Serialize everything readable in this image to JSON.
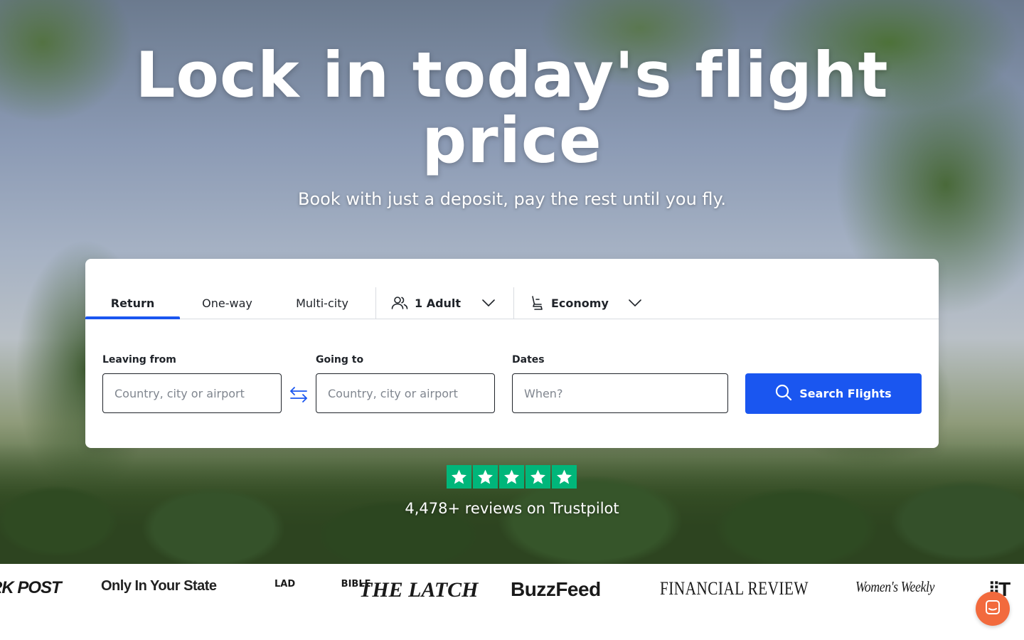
{
  "hero": {
    "title": "Lock in today's flight price",
    "subtitle": "Book with just a deposit, pay the rest until you fly."
  },
  "search": {
    "tabs": [
      {
        "label": "Return",
        "active": true
      },
      {
        "label": "One-way",
        "active": false
      },
      {
        "label": "Multi-city",
        "active": false
      }
    ],
    "passengers": {
      "label": "1 Adult",
      "icon": "users-icon"
    },
    "cabin": {
      "label": "Economy",
      "icon": "seat-icon"
    },
    "leaving": {
      "label": "Leaving from",
      "placeholder": "Country, city or airport",
      "value": ""
    },
    "going": {
      "label": "Going to",
      "placeholder": "Country, city or airport",
      "value": ""
    },
    "dates": {
      "label": "Dates",
      "placeholder": "When?",
      "value": ""
    },
    "button_label": "Search Flights",
    "accent": "#1a56f0"
  },
  "trustpilot": {
    "stars": 5,
    "star_color": "#00b67a",
    "text": "4,478+ reviews on Trustpilot"
  },
  "press_logos": [
    "RK POST",
    "Only In Your State",
    "LAD BIBLE",
    "THE LATCH",
    "BuzzFeed",
    "FINANCIAL REVIEW",
    "Women's Weekly",
    "T"
  ],
  "chat": {
    "icon": "chat-icon",
    "color": "#f26a3d"
  }
}
